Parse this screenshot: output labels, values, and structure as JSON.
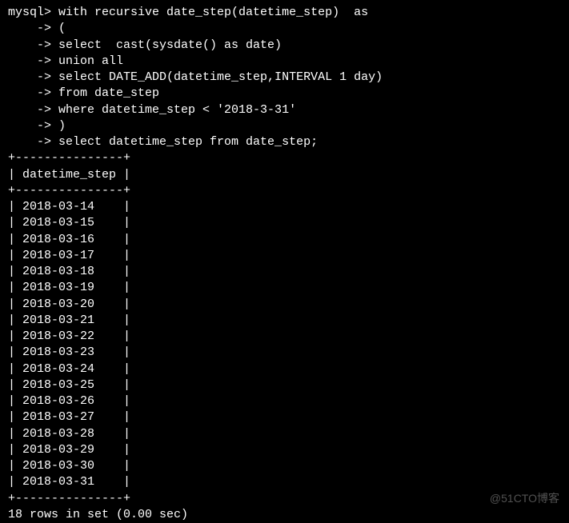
{
  "prompt": "mysql>",
  "cont_prompt": "    ->",
  "query_lines": [
    " with recursive date_step(datetime_step)  as",
    " (",
    " select  cast(sysdate() as date)",
    " union all",
    " select DATE_ADD(datetime_step,INTERVAL 1 day)",
    " from date_step",
    " where datetime_step < '2018-3-31'",
    " )",
    " select datetime_step from date_step;"
  ],
  "table": {
    "border": "+---------------+",
    "header": "| datetime_step |",
    "rows": [
      "| 2018-03-14    |",
      "| 2018-03-15    |",
      "| 2018-03-16    |",
      "| 2018-03-17    |",
      "| 2018-03-18    |",
      "| 2018-03-19    |",
      "| 2018-03-20    |",
      "| 2018-03-21    |",
      "| 2018-03-22    |",
      "| 2018-03-23    |",
      "| 2018-03-24    |",
      "| 2018-03-25    |",
      "| 2018-03-26    |",
      "| 2018-03-27    |",
      "| 2018-03-28    |",
      "| 2018-03-29    |",
      "| 2018-03-30    |",
      "| 2018-03-31    |"
    ]
  },
  "footer": "18 rows in set (0.00 sec)",
  "watermark": "@51CTO博客"
}
